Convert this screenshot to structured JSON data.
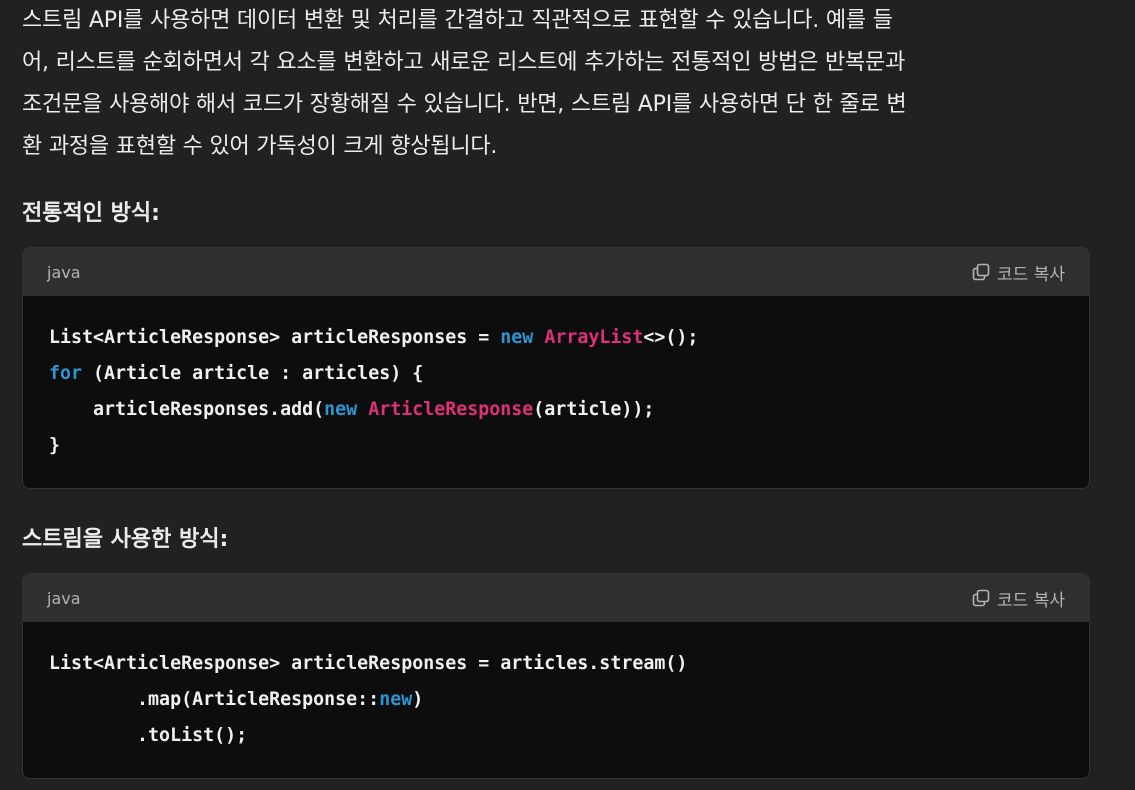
{
  "intro": {
    "lines": [
      "스트림 API를 사용하면 데이터 변환 및 처리를 간결하고 직관적으로 표현할 수 있습니다. 예를 들",
      "어, 리스트를 순회하면서 각 요소를 변환하고 새로운 리스트에 추가하는 전통적인 방법은 반복문과",
      "조건문을 사용해야 해서 코드가 장황해질 수 있습니다. 반면, 스트림 API를 사용하면 단 한 줄로 변",
      "환 과정을 표현할 수 있어 가독성이 크게 향상됩니다."
    ]
  },
  "sections": [
    {
      "heading": "전통적인 방식:",
      "code_block": {
        "language": "java",
        "copy_label": "코드 복사",
        "lines": [
          [
            {
              "t": "List<ArticleResponse> articleResponses = ",
              "k": "plain"
            },
            {
              "t": "new",
              "k": "keyword"
            },
            {
              "t": " ",
              "k": "plain"
            },
            {
              "t": "ArrayList",
              "k": "class"
            },
            {
              "t": "<>();",
              "k": "plain"
            }
          ],
          [
            {
              "t": "for",
              "k": "keyword"
            },
            {
              "t": " (Article article : articles) {",
              "k": "plain"
            }
          ],
          [
            {
              "t": "    articleResponses.add(",
              "k": "plain"
            },
            {
              "t": "new",
              "k": "keyword"
            },
            {
              "t": " ",
              "k": "plain"
            },
            {
              "t": "ArticleResponse",
              "k": "class"
            },
            {
              "t": "(article));",
              "k": "plain"
            }
          ],
          [
            {
              "t": "}",
              "k": "plain"
            }
          ]
        ]
      }
    },
    {
      "heading": "스트림을 사용한 방식:",
      "code_block": {
        "language": "java",
        "copy_label": "코드 복사",
        "lines": [
          [
            {
              "t": "List<ArticleResponse> articleResponses = articles.stream()",
              "k": "plain"
            }
          ],
          [
            {
              "t": "        .map(ArticleResponse::",
              "k": "plain"
            },
            {
              "t": "new",
              "k": "keyword"
            },
            {
              "t": ")",
              "k": "plain"
            }
          ],
          [
            {
              "t": "        .toList();",
              "k": "plain"
            }
          ]
        ]
      }
    }
  ],
  "icons": {
    "copy": "copy-icon"
  },
  "colors": {
    "background": "#212121",
    "code_background": "#0d0d0d",
    "code_header": "#2f2f2f",
    "keyword": "#2e95d3",
    "class_name": "#df3079",
    "text": "#ececec"
  }
}
